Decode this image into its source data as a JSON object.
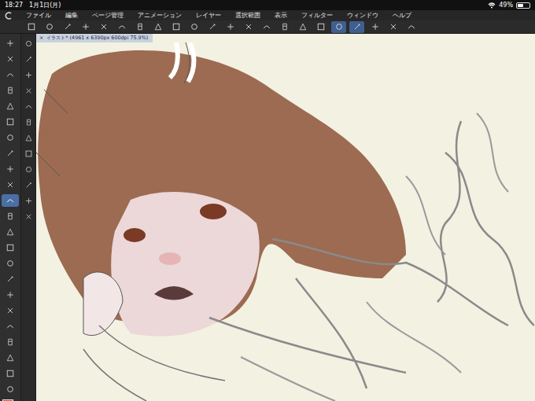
{
  "status_bar": {
    "time": "18:27",
    "date": "1月1日(月)",
    "battery": "49%",
    "battery_level": 0.49
  },
  "menu": [
    "ファイル",
    "編集",
    "ページ管理",
    "アニメーション",
    "レイヤー",
    "選択範囲",
    "表示",
    "フィルター",
    "ウィンドウ",
    "ヘルプ"
  ],
  "toolbar": {
    "buttons": [
      {
        "selected": false
      },
      {
        "selected": false
      },
      {
        "selected": false
      },
      {
        "selected": false
      },
      {
        "selected": false
      },
      {
        "selected": false
      },
      {
        "selected": false
      },
      {
        "selected": false
      },
      {
        "selected": false
      },
      {
        "selected": false
      },
      {
        "selected": false
      },
      {
        "selected": false
      },
      {
        "selected": false
      },
      {
        "selected": false
      },
      {
        "selected": false
      },
      {
        "selected": false
      },
      {
        "selected": false
      },
      {
        "selected": true
      },
      {
        "selected": true
      },
      {
        "selected": false
      },
      {
        "selected": false
      },
      {
        "selected": false
      }
    ]
  },
  "tools": [
    {
      "selected": false
    },
    {
      "selected": false
    },
    {
      "selected": false
    },
    {
      "selected": false
    },
    {
      "selected": false
    },
    {
      "selected": false
    },
    {
      "selected": false
    },
    {
      "selected": false
    },
    {
      "selected": false
    },
    {
      "selected": false
    },
    {
      "selected": true
    },
    {
      "selected": false
    },
    {
      "selected": false
    },
    {
      "selected": false
    },
    {
      "selected": false
    },
    {
      "selected": false
    },
    {
      "selected": false
    },
    {
      "selected": false
    },
    {
      "selected": false
    },
    {
      "selected": false
    },
    {
      "selected": false
    },
    {
      "selected": false
    },
    {
      "selected": false
    }
  ],
  "subtools": [
    {
      "selected": false
    },
    {
      "selected": false
    },
    {
      "selected": false
    },
    {
      "selected": false
    },
    {
      "selected": false
    },
    {
      "selected": false
    },
    {
      "selected": false
    },
    {
      "selected": false
    },
    {
      "selected": false
    },
    {
      "selected": false
    },
    {
      "selected": false
    },
    {
      "selected": false
    }
  ],
  "document_tab": {
    "close": "×",
    "title": "イラスト* (4961 x 6390px 600dpi 75.9%)"
  },
  "colors": {
    "main": "#d4452b",
    "sub": "#ffffff"
  }
}
